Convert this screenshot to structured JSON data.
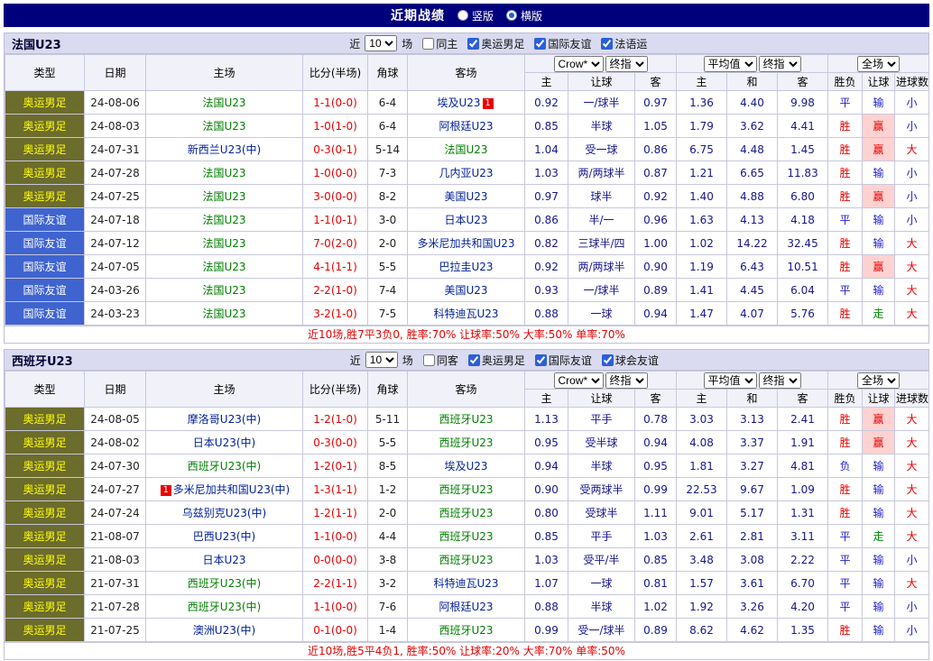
{
  "topbar": {
    "title": "近期战绩",
    "radios": [
      {
        "label": "竖版",
        "selected": false
      },
      {
        "label": "横版",
        "selected": true
      }
    ]
  },
  "colors": {
    "topbar_bg": "#00007D",
    "section_bar_bg": "#DADAF0",
    "olympic_type_bg": "#6C6C2D",
    "olympic_type_text": "#FFFF00",
    "friendly_type_bg": "#4064CF",
    "featured_team": "#008000",
    "team_link": "#001F9C",
    "score_red": "#E80000",
    "result_blue": "#2121CC",
    "result_green": "#008800",
    "win_highlight_bg": "#FFD2D2"
  },
  "table_header": {
    "static_cols": [
      "类型",
      "日期",
      "主场",
      "比分(半场)",
      "角球",
      "客场"
    ],
    "group1_selects": [
      "Crow*",
      "终指"
    ],
    "group2_selects": [
      "平均值",
      "终指"
    ],
    "group3_selects": [
      "全场"
    ],
    "sub_cols1": [
      "主",
      "让球",
      "客"
    ],
    "sub_cols2": [
      "主",
      "和",
      "客"
    ],
    "sub_cols3": [
      "胜负",
      "让球",
      "进球数"
    ]
  },
  "sections": [
    {
      "team": "法国U23",
      "filter": {
        "near": "近",
        "count": "10",
        "unit": "场",
        "checks": [
          {
            "label": "同主",
            "on": false
          },
          {
            "label": "奥运男足",
            "on": true
          },
          {
            "label": "国际友谊",
            "on": true
          },
          {
            "label": "法语运",
            "on": true
          }
        ]
      },
      "rows": [
        {
          "type": "奥运男足",
          "date": "24-08-06",
          "home": "法国U23",
          "home_featured": true,
          "score": "1-1(0-0)",
          "corners": "6-4",
          "away": "埃及U23",
          "away_badge": "1",
          "odds": [
            "0.92",
            "一/球半",
            "0.97"
          ],
          "avg": [
            "1.36",
            "4.40",
            "9.98"
          ],
          "results": [
            [
              "平",
              "blue"
            ],
            [
              "输",
              "blue"
            ],
            [
              "小",
              "blue"
            ]
          ]
        },
        {
          "type": "奥运男足",
          "date": "24-08-03",
          "home": "法国U23",
          "home_featured": true,
          "score": "1-0(1-0)",
          "corners": "6-4",
          "away": "阿根廷U23",
          "odds": [
            "0.85",
            "半球",
            "1.05"
          ],
          "avg": [
            "1.79",
            "3.62",
            "4.41"
          ],
          "results": [
            [
              "胜",
              "red"
            ],
            [
              "赢",
              "redbg"
            ],
            [
              "小",
              "blue"
            ]
          ]
        },
        {
          "type": "奥运男足",
          "date": "24-07-31",
          "home": "新西兰U23(中)",
          "score": "0-3(0-1)",
          "corners": "5-14",
          "away": "法国U23",
          "away_featured": true,
          "odds": [
            "1.04",
            "受一球",
            "0.86"
          ],
          "avg": [
            "6.75",
            "4.48",
            "1.45"
          ],
          "results": [
            [
              "胜",
              "red"
            ],
            [
              "赢",
              "redbg"
            ],
            [
              "大",
              "red"
            ]
          ]
        },
        {
          "type": "奥运男足",
          "date": "24-07-28",
          "home": "法国U23",
          "home_featured": true,
          "score": "1-0(0-0)",
          "corners": "7-3",
          "away": "几内亚U23",
          "odds": [
            "1.03",
            "两/两球半",
            "0.87"
          ],
          "avg": [
            "1.21",
            "6.65",
            "11.83"
          ],
          "results": [
            [
              "胜",
              "red"
            ],
            [
              "输",
              "blue"
            ],
            [
              "小",
              "blue"
            ]
          ]
        },
        {
          "type": "奥运男足",
          "date": "24-07-25",
          "home": "法国U23",
          "home_featured": true,
          "score": "3-0(0-0)",
          "corners": "8-2",
          "away": "美国U23",
          "odds": [
            "0.97",
            "球半",
            "0.92"
          ],
          "avg": [
            "1.40",
            "4.88",
            "6.80"
          ],
          "results": [
            [
              "胜",
              "red"
            ],
            [
              "赢",
              "redbg"
            ],
            [
              "小",
              "blue"
            ]
          ]
        },
        {
          "type": "国际友谊",
          "date": "24-07-18",
          "home": "法国U23",
          "home_featured": true,
          "score": "1-1(0-1)",
          "corners": "3-0",
          "away": "日本U23",
          "odds": [
            "0.86",
            "半/一",
            "0.96"
          ],
          "avg": [
            "1.63",
            "4.13",
            "4.18"
          ],
          "results": [
            [
              "平",
              "blue"
            ],
            [
              "输",
              "blue"
            ],
            [
              "小",
              "blue"
            ]
          ]
        },
        {
          "type": "国际友谊",
          "date": "24-07-12",
          "home": "法国U23",
          "home_featured": true,
          "score": "7-0(2-0)",
          "corners": "2-0",
          "away": "多米尼加共和国U23",
          "odds": [
            "0.82",
            "三球半/四",
            "1.00"
          ],
          "avg": [
            "1.02",
            "14.22",
            "32.45"
          ],
          "results": [
            [
              "胜",
              "red"
            ],
            [
              "输",
              "blue"
            ],
            [
              "大",
              "red"
            ]
          ]
        },
        {
          "type": "国际友谊",
          "date": "24-07-05",
          "home": "法国U23",
          "home_featured": true,
          "score": "4-1(1-1)",
          "corners": "5-5",
          "away": "巴拉圭U23",
          "odds": [
            "0.92",
            "两/两球半",
            "0.90"
          ],
          "avg": [
            "1.19",
            "6.43",
            "10.51"
          ],
          "results": [
            [
              "胜",
              "red"
            ],
            [
              "赢",
              "redbg"
            ],
            [
              "大",
              "red"
            ]
          ]
        },
        {
          "type": "国际友谊",
          "date": "24-03-26",
          "home": "法国U23",
          "home_featured": true,
          "score": "2-2(1-0)",
          "corners": "7-4",
          "away": "美国U23",
          "odds": [
            "0.93",
            "一/球半",
            "0.89"
          ],
          "avg": [
            "1.41",
            "4.45",
            "6.04"
          ],
          "results": [
            [
              "平",
              "blue"
            ],
            [
              "输",
              "blue"
            ],
            [
              "大",
              "red"
            ]
          ]
        },
        {
          "type": "国际友谊",
          "date": "24-03-23",
          "home": "法国U23",
          "home_featured": true,
          "score": "3-2(1-0)",
          "corners": "7-5",
          "away": "科特迪瓦U23",
          "odds": [
            "0.88",
            "一球",
            "0.94"
          ],
          "avg": [
            "1.47",
            "4.07",
            "5.76"
          ],
          "results": [
            [
              "胜",
              "red"
            ],
            [
              "走",
              "green"
            ],
            [
              "大",
              "red"
            ]
          ]
        }
      ],
      "footer": "近10场,胜7平3负0, 胜率:70% 让球率:50% 大率:50% 单率:70%"
    },
    {
      "team": "西班牙U23",
      "filter": {
        "near": "近",
        "count": "10",
        "unit": "场",
        "checks": [
          {
            "label": "同客",
            "on": false
          },
          {
            "label": "奥运男足",
            "on": true
          },
          {
            "label": "国际友谊",
            "on": true
          },
          {
            "label": "球会友谊",
            "on": true
          }
        ]
      },
      "rows": [
        {
          "type": "奥运男足",
          "date": "24-08-05",
          "home": "摩洛哥U23(中)",
          "score": "1-2(1-0)",
          "corners": "5-11",
          "away": "西班牙U23",
          "away_featured": true,
          "odds": [
            "1.13",
            "平手",
            "0.78"
          ],
          "avg": [
            "3.03",
            "3.13",
            "2.41"
          ],
          "results": [
            [
              "胜",
              "red"
            ],
            [
              "赢",
              "redbg"
            ],
            [
              "大",
              "red"
            ]
          ]
        },
        {
          "type": "奥运男足",
          "date": "24-08-02",
          "home": "日本U23(中)",
          "score": "0-3(0-0)",
          "corners": "5-5",
          "away": "西班牙U23",
          "away_featured": true,
          "odds": [
            "0.95",
            "受半球",
            "0.94"
          ],
          "avg": [
            "4.08",
            "3.37",
            "1.91"
          ],
          "results": [
            [
              "胜",
              "red"
            ],
            [
              "赢",
              "redbg"
            ],
            [
              "大",
              "red"
            ]
          ]
        },
        {
          "type": "奥运男足",
          "date": "24-07-30",
          "home": "西班牙U23(中)",
          "home_featured": true,
          "score": "1-2(0-1)",
          "corners": "8-5",
          "away": "埃及U23",
          "odds": [
            "0.94",
            "半球",
            "0.95"
          ],
          "avg": [
            "1.81",
            "3.27",
            "4.81"
          ],
          "results": [
            [
              "负",
              "blue"
            ],
            [
              "输",
              "blue"
            ],
            [
              "大",
              "red"
            ]
          ]
        },
        {
          "type": "奥运男足",
          "date": "24-07-27",
          "home": "多米尼加共和国U23(中)",
          "home_badge": "1",
          "score": "1-3(1-1)",
          "corners": "1-2",
          "away": "西班牙U23",
          "away_featured": true,
          "odds": [
            "0.90",
            "受两球半",
            "0.99"
          ],
          "avg": [
            "22.53",
            "9.67",
            "1.09"
          ],
          "results": [
            [
              "胜",
              "red"
            ],
            [
              "输",
              "blue"
            ],
            [
              "大",
              "red"
            ]
          ]
        },
        {
          "type": "奥运男足",
          "date": "24-07-24",
          "home": "乌兹别克U23(中)",
          "score": "1-2(1-1)",
          "corners": "2-0",
          "away": "西班牙U23",
          "away_featured": true,
          "odds": [
            "0.80",
            "受球半",
            "1.11"
          ],
          "avg": [
            "9.01",
            "5.17",
            "1.31"
          ],
          "results": [
            [
              "胜",
              "red"
            ],
            [
              "输",
              "blue"
            ],
            [
              "大",
              "red"
            ]
          ]
        },
        {
          "type": "奥运男足",
          "date": "21-08-07",
          "home": "巴西U23(中)",
          "score": "1-1(0-0)",
          "corners": "4-4",
          "away": "西班牙U23",
          "away_featured": true,
          "odds": [
            "0.85",
            "平手",
            "1.03"
          ],
          "avg": [
            "2.61",
            "2.81",
            "3.11"
          ],
          "results": [
            [
              "平",
              "blue"
            ],
            [
              "走",
              "green"
            ],
            [
              "大",
              "red"
            ]
          ]
        },
        {
          "type": "奥运男足",
          "date": "21-08-03",
          "home": "日本U23",
          "score": "0-0(0-0)",
          "corners": "3-8",
          "away": "西班牙U23",
          "away_featured": true,
          "odds": [
            "1.03",
            "受平/半",
            "0.85"
          ],
          "avg": [
            "3.48",
            "3.08",
            "2.22"
          ],
          "results": [
            [
              "平",
              "blue"
            ],
            [
              "输",
              "blue"
            ],
            [
              "小",
              "blue"
            ]
          ]
        },
        {
          "type": "奥运男足",
          "date": "21-07-31",
          "home": "西班牙U23(中)",
          "home_featured": true,
          "score": "2-2(1-1)",
          "corners": "3-2",
          "away": "科特迪瓦U23",
          "odds": [
            "1.07",
            "一球",
            "0.81"
          ],
          "avg": [
            "1.57",
            "3.61",
            "6.70"
          ],
          "results": [
            [
              "平",
              "blue"
            ],
            [
              "输",
              "blue"
            ],
            [
              "大",
              "red"
            ]
          ]
        },
        {
          "type": "奥运男足",
          "date": "21-07-28",
          "home": "西班牙U23(中)",
          "home_featured": true,
          "score": "1-1(0-0)",
          "corners": "7-6",
          "away": "阿根廷U23",
          "odds": [
            "0.88",
            "半球",
            "1.02"
          ],
          "avg": [
            "1.92",
            "3.26",
            "4.20"
          ],
          "results": [
            [
              "平",
              "blue"
            ],
            [
              "输",
              "blue"
            ],
            [
              "小",
              "blue"
            ]
          ]
        },
        {
          "type": "奥运男足",
          "date": "21-07-25",
          "home": "澳洲U23(中)",
          "score": "0-1(0-0)",
          "corners": "1-4",
          "away": "西班牙U23",
          "away_featured": true,
          "odds": [
            "0.99",
            "受一/球半",
            "0.89"
          ],
          "avg": [
            "8.62",
            "4.62",
            "1.35"
          ],
          "results": [
            [
              "胜",
              "red"
            ],
            [
              "输",
              "blue"
            ],
            [
              "小",
              "blue"
            ]
          ]
        }
      ],
      "footer": "近10场,胜5平4负1, 胜率:50% 让球率:20% 大率:70% 单率:50%"
    }
  ]
}
